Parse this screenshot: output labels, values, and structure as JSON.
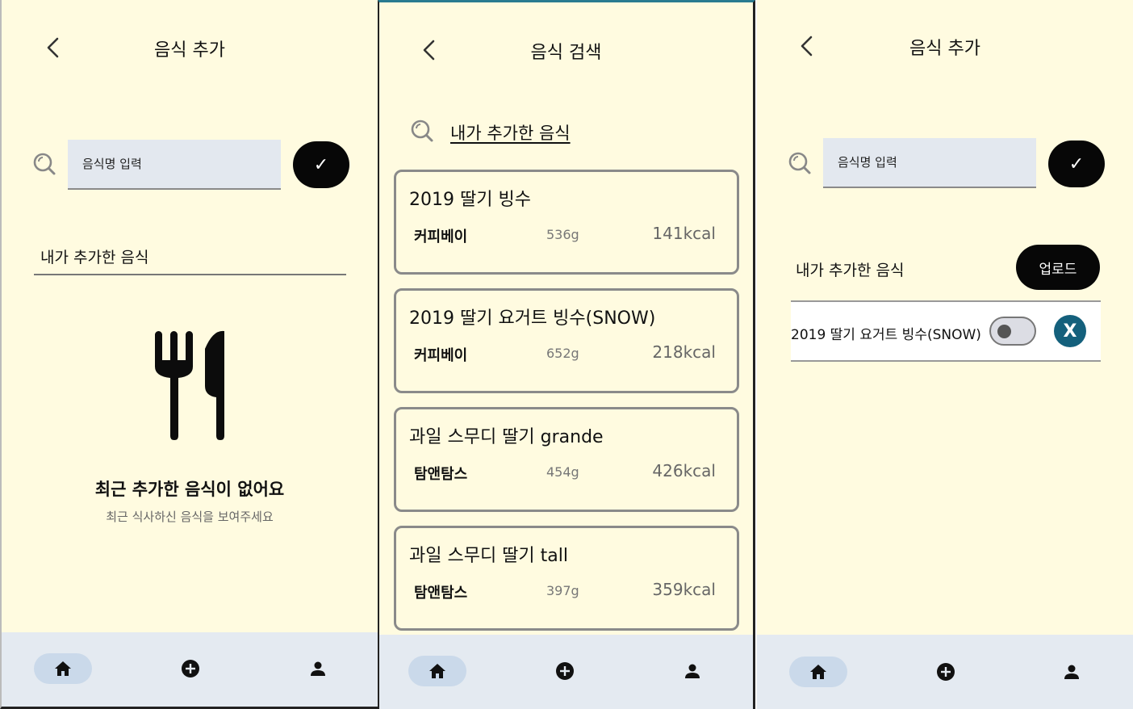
{
  "screen1": {
    "title": "음식 추가",
    "input_placeholder": "음식명 입력",
    "confirm_label": "✓",
    "section_label": "내가 추가한 음식",
    "empty_title": "최근 추가한 음식이 없어요",
    "empty_subtitle": "최근 식사하신 음식을 보여주세요"
  },
  "screen2": {
    "title": "음식 검색",
    "search_link": "내가 추가한 음식",
    "results": [
      {
        "name": "2019 딸기 빙수",
        "brand": "커피베이",
        "weight": "536g",
        "kcal": "141kcal"
      },
      {
        "name": "2019 딸기 요거트 빙수(SNOW)",
        "brand": "커피베이",
        "weight": "652g",
        "kcal": "218kcal"
      },
      {
        "name": "과일 스무디 딸기 grande",
        "brand": "탐앤탐스",
        "weight": "454g",
        "kcal": "426kcal"
      },
      {
        "name": "과일 스무디 딸기 tall",
        "brand": "탐앤탐스",
        "weight": "397g",
        "kcal": "359kcal"
      }
    ]
  },
  "screen3": {
    "title": "음식 추가",
    "input_placeholder": "음식명 입력",
    "confirm_label": "✓",
    "section_label": "내가 추가한 음식",
    "upload_label": "업로드",
    "food_item": {
      "name": "2019 딸기 요거트 빙수(SNOW)",
      "toggle_on": false,
      "remove_label": "X"
    }
  },
  "nav": {
    "items": [
      {
        "icon": "home-icon",
        "active": true
      },
      {
        "icon": "add-circle-icon",
        "active": false
      },
      {
        "icon": "person-icon",
        "active": false
      }
    ]
  },
  "colors": {
    "background": "#fffbe0",
    "input_bg": "#e3e8ef",
    "nav_bg": "#e4eaf1",
    "nav_active": "#cad9ea",
    "primary_button": "#070707",
    "remove_button": "#14607c"
  }
}
